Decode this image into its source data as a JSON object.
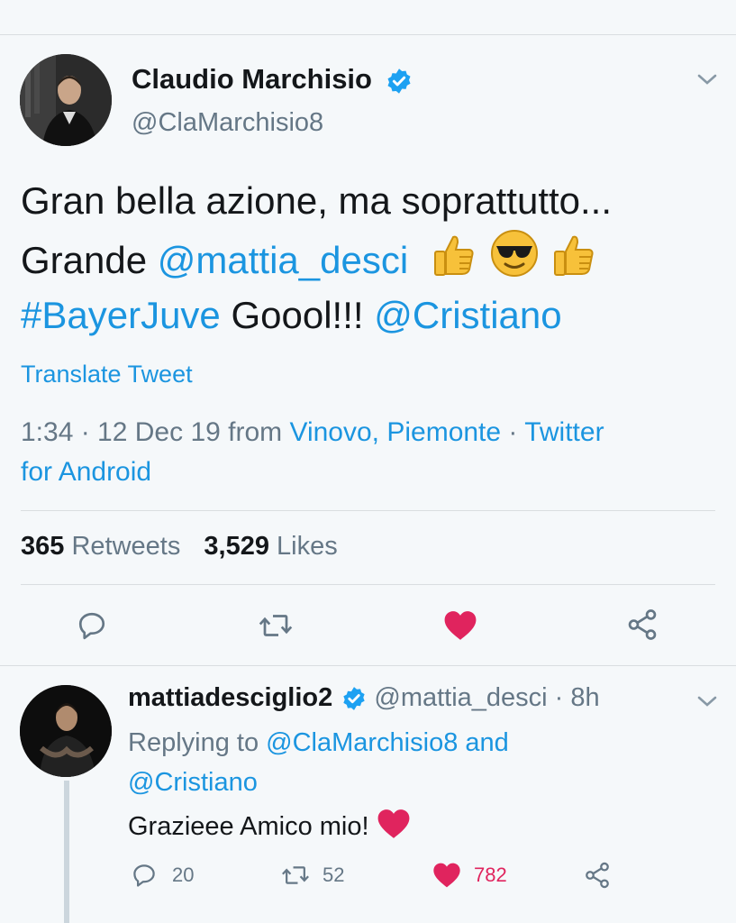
{
  "main_tweet": {
    "display_name": "Claudio Marchisio",
    "handle": "@ClaMarchisio8",
    "text_line1": "Gran bella azione, ma soprattutto...",
    "text_line2_prefix": "Grande ",
    "mention1": "@mattia_desci",
    "hashtag": "#BayerJuve",
    "text_mid": " Gooo",
    "text_mid2": "l!!! ",
    "mention2": "@Cristiano",
    "translate": "Translate Tweet",
    "time": "1:34 · 12 Dec 19 from ",
    "location": "Vinovo, Piemonte",
    "sep": " · ",
    "client_line1": "Twitter",
    "client_line2": "for Android",
    "retweets_count": "365",
    "retweets_label": " Retweets",
    "likes_count": "3,529",
    "likes_label": " Likes"
  },
  "reply_tweet": {
    "display_name": "mattiadesciglio2",
    "handle": "@mattia_desci",
    "age": " · 8h",
    "replying_to": "Replying to ",
    "reply_mention1": "@ClaMarchisio8",
    "reply_and": " and",
    "reply_mention2": "@Cristiano",
    "text": "Grazieee Amico mio! ",
    "reply_count": "20",
    "retweet_count": "52",
    "like_count": "782"
  },
  "colors": {
    "accent": "#1b95e0",
    "like": "#e0245e",
    "muted": "#657786"
  }
}
